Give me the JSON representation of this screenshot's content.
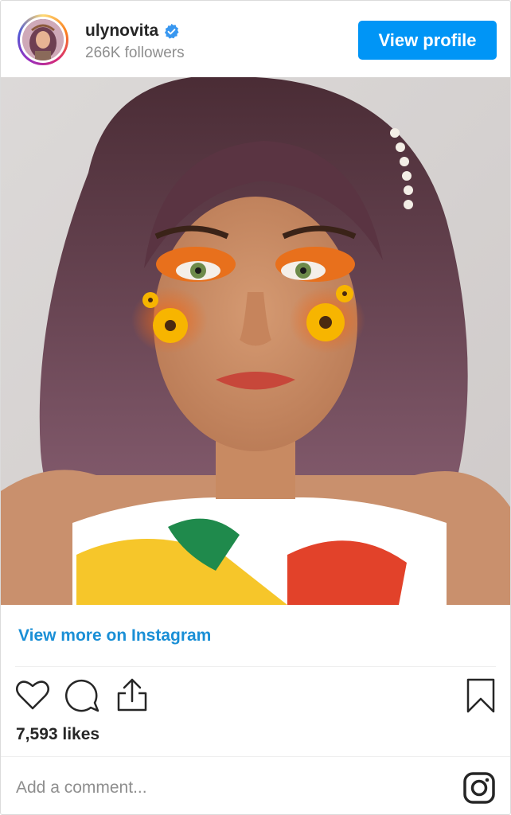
{
  "header": {
    "username": "ulynovita",
    "followers": "266K followers",
    "view_profile_label": "View profile"
  },
  "post": {
    "view_more_label": "View more on Instagram",
    "likes": "7,593 likes",
    "comment_placeholder": "Add a comment..."
  },
  "icons": {
    "verified": "verified-badge-icon",
    "like": "heart-icon",
    "comment": "comment-bubble-icon",
    "share": "share-upload-icon",
    "save": "bookmark-icon",
    "instagram": "instagram-logo-icon"
  },
  "colors": {
    "accent": "#0095f6",
    "link": "#1a8fd6",
    "text": "#262626",
    "muted": "#8e8e8e"
  }
}
